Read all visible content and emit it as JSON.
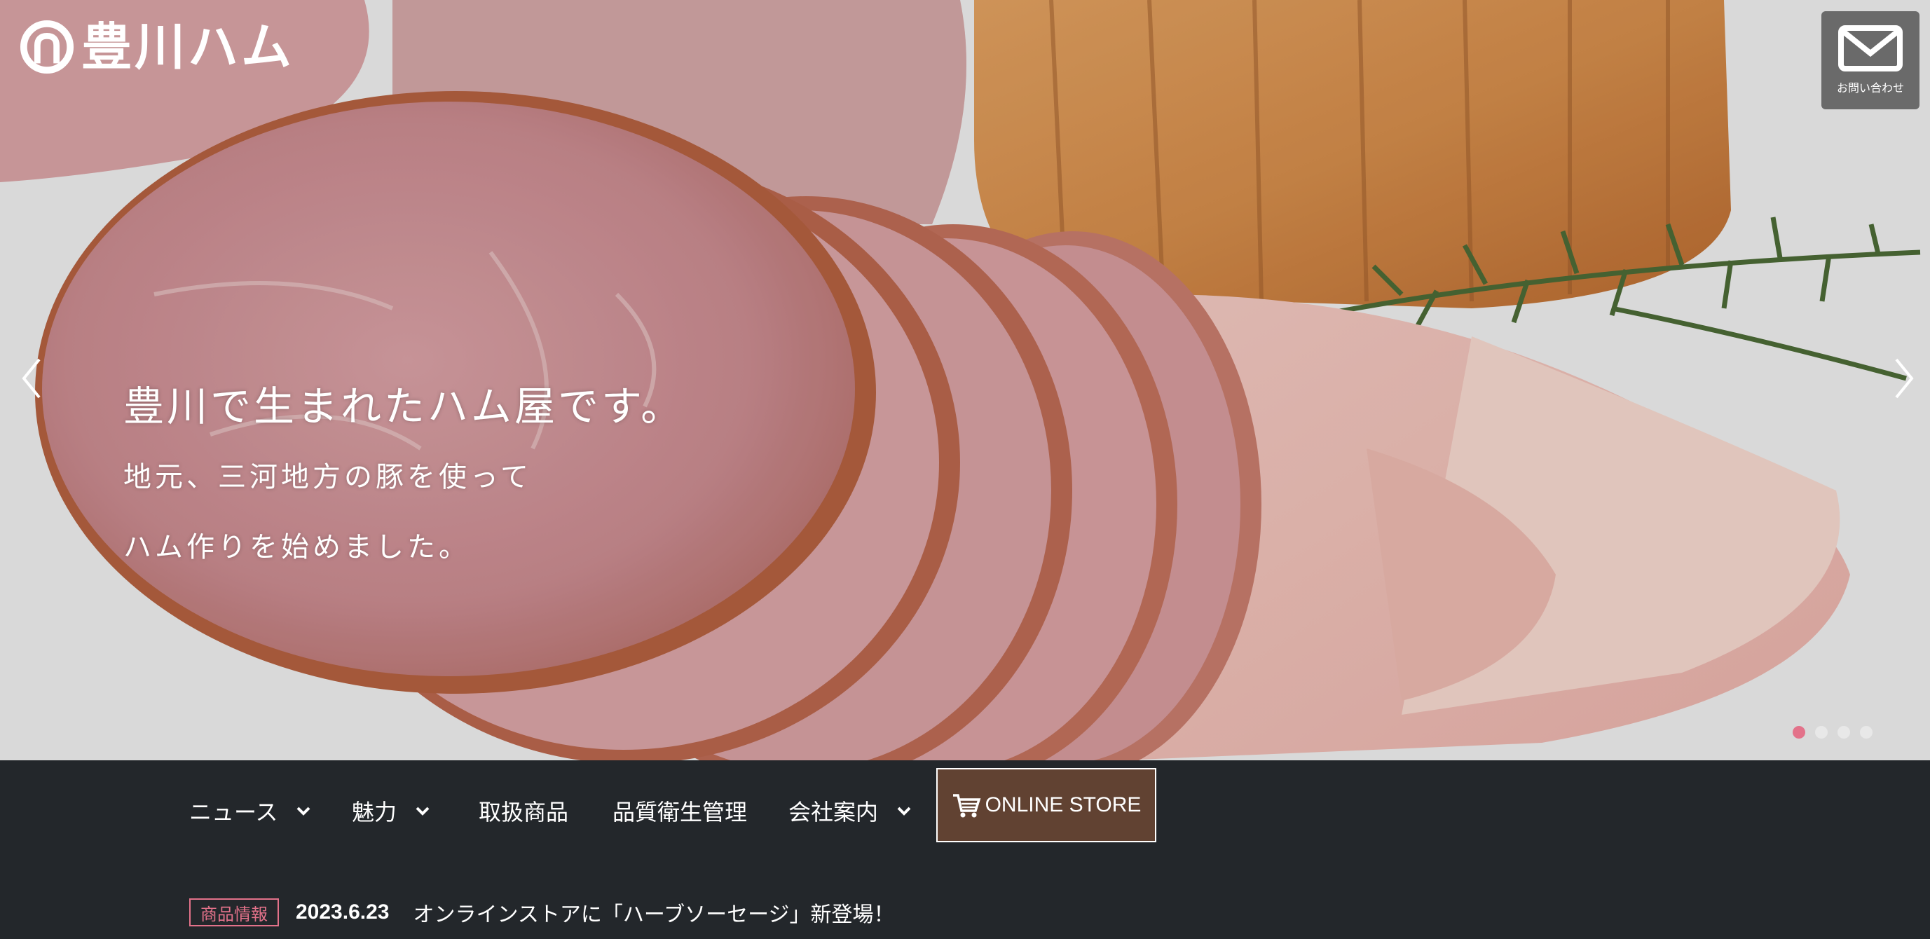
{
  "brand": {
    "logo_text": "豊川ハム"
  },
  "header": {
    "contact_label": "お問い合わせ"
  },
  "hero": {
    "title": "豊川で生まれたハム屋です。",
    "subtitle_line1": "地元、三河地方の豚を使って",
    "subtitle_line2": "ハム作りを始めました。",
    "slide_count": 4,
    "active_slide": 1
  },
  "nav": {
    "items": [
      {
        "label": "ニュース",
        "has_dropdown": true
      },
      {
        "label": "魅力",
        "has_dropdown": true
      },
      {
        "label": "取扱商品",
        "has_dropdown": false
      },
      {
        "label": "品質衛生管理",
        "has_dropdown": false
      },
      {
        "label": "会社案内",
        "has_dropdown": true
      }
    ],
    "store_label": "ONLINE STORE"
  },
  "news": {
    "tag": "商品情報",
    "date": "2023.6.23",
    "title": "オンラインストアに「ハーブソーセージ」新登場！"
  },
  "colors": {
    "nav_bg": "#23272b",
    "accent_pink": "#e3728a",
    "store_bg": "#614232",
    "contact_bg": "#6a6a6a"
  }
}
